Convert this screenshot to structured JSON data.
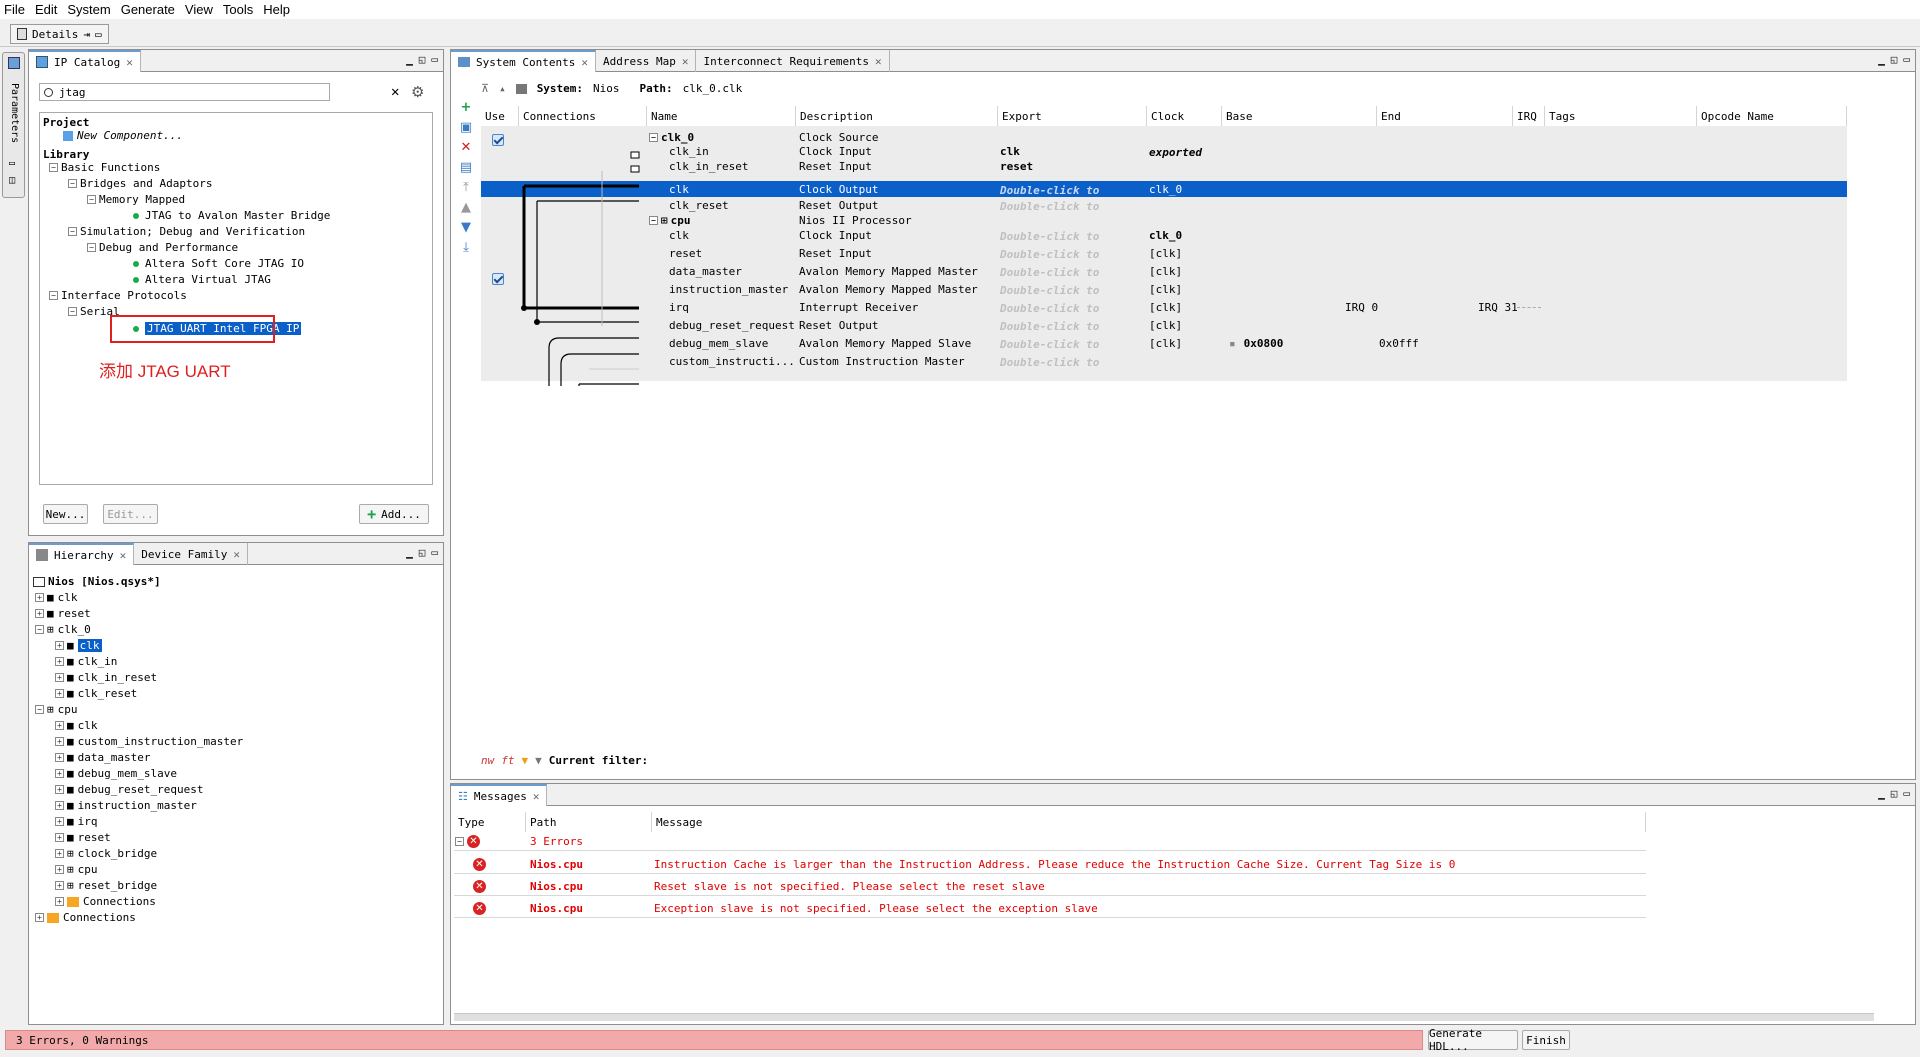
{
  "menu": [
    "File",
    "Edit",
    "System",
    "Generate",
    "View",
    "Tools",
    "Help"
  ],
  "details_tab": "Details",
  "vertical_tab": "Parameters",
  "ip_catalog": {
    "tab": "IP Catalog",
    "search_value": "jtag",
    "project_label": "Project",
    "new_component": "New Component...",
    "library_label": "Library",
    "tree": [
      "Basic Functions",
      "Bridges and Adaptors",
      "Memory Mapped",
      "JTAG to Avalon Master Bridge",
      "Simulation; Debug and Verification",
      "Debug and Performance",
      "Altera Soft Core JTAG IO",
      "Altera Virtual JTAG",
      "Interface Protocols",
      "Serial",
      "JTAG UART Intel FPGA IP"
    ],
    "annotation": "添加 JTAG UART",
    "buttons": {
      "new": "New...",
      "edit": "Edit...",
      "add": "Add..."
    }
  },
  "hierarchy": {
    "tabs": [
      "Hierarchy",
      "Device Family"
    ],
    "root": "Nios [Nios.qsys*]",
    "items": [
      "clk",
      "reset",
      "clk_0",
      "clk",
      "clk_in",
      "clk_in_reset",
      "clk_reset",
      "cpu",
      "clk",
      "custom_instruction_master",
      "data_master",
      "debug_mem_slave",
      "debug_reset_request",
      "instruction_master",
      "irq",
      "reset",
      "clock_bridge",
      "cpu",
      "reset_bridge",
      "Connections",
      "Connections"
    ]
  },
  "system": {
    "tabs": [
      "System Contents",
      "Address Map",
      "Interconnect Requirements"
    ],
    "system_label": "System:",
    "system_name": "Nios",
    "path_label": "Path:",
    "path_value": "clk_0.clk",
    "columns": [
      "Use",
      "Connections",
      "Name",
      "Description",
      "Export",
      "Clock",
      "Base",
      "End",
      "IRQ",
      "Tags",
      "Opcode Name"
    ],
    "rows": [
      {
        "name": "clk_0",
        "desc": "Clock Source",
        "export": "",
        "clock": "",
        "base": "",
        "end": ""
      },
      {
        "name": "clk_in",
        "desc": "Clock Input",
        "export": "clk",
        "clock": "exported",
        "base": "",
        "end": ""
      },
      {
        "name": "clk_in_reset",
        "desc": "Reset Input",
        "export": "reset",
        "clock": "",
        "base": "",
        "end": ""
      },
      {
        "name": "clk",
        "desc": "Clock Output",
        "export": "Double-click to",
        "clock": "clk_0",
        "base": "",
        "end": ""
      },
      {
        "name": "clk_reset",
        "desc": "Reset Output",
        "export": "Double-click to",
        "clock": "",
        "base": "",
        "end": ""
      },
      {
        "name": "cpu",
        "desc": "Nios II Processor",
        "export": "",
        "clock": "",
        "base": "",
        "end": ""
      },
      {
        "name": "clk",
        "desc": "Clock Input",
        "export": "Double-click to",
        "clock": "clk_0",
        "base": "",
        "end": ""
      },
      {
        "name": "reset",
        "desc": "Reset Input",
        "export": "Double-click to",
        "clock": "[clk]",
        "base": "",
        "end": ""
      },
      {
        "name": "data_master",
        "desc": "Avalon Memory Mapped Master",
        "export": "Double-click to",
        "clock": "[clk]",
        "base": "",
        "end": ""
      },
      {
        "name": "instruction_master",
        "desc": "Avalon Memory Mapped Master",
        "export": "Double-click to",
        "clock": "[clk]",
        "base": "",
        "end": ""
      },
      {
        "name": "irq",
        "desc": "Interrupt Receiver",
        "export": "Double-click to",
        "clock": "[clk]",
        "base": "IRQ 0",
        "end": "IRQ 31"
      },
      {
        "name": "debug_reset_request",
        "desc": "Reset Output",
        "export": "Double-click to",
        "clock": "[clk]",
        "base": "",
        "end": ""
      },
      {
        "name": "debug_mem_slave",
        "desc": "Avalon Memory Mapped Slave",
        "export": "Double-click to",
        "clock": "[clk]",
        "base": "0x0800",
        "end": "0x0fff"
      },
      {
        "name": "custom_instructi...",
        "desc": "Custom Instruction Master",
        "export": "Double-click to",
        "clock": "",
        "base": "",
        "end": ""
      }
    ],
    "filter_label": "Current filter:"
  },
  "messages": {
    "tab": "Messages",
    "columns": [
      "Type",
      "Path",
      "Message"
    ],
    "summary": "3 Errors",
    "rows": [
      {
        "path": "Nios.cpu",
        "message": "Instruction Cache is larger than the Instruction Address. Please reduce the Instruction Cache Size. Current Tag Size is 0"
      },
      {
        "path": "Nios.cpu",
        "message": "Reset slave is not specified. Please select the reset slave"
      },
      {
        "path": "Nios.cpu",
        "message": "Exception slave is not specified. Please select the exception slave"
      }
    ]
  },
  "status": {
    "text": "3 Errors, 0 Warnings",
    "generate": "Generate HDL...",
    "finish": "Finish"
  },
  "colors": {
    "selection": "#0a5fc8",
    "error": "#e00000",
    "status_bg": "#f2a9a9",
    "annotation": "#e02020"
  }
}
